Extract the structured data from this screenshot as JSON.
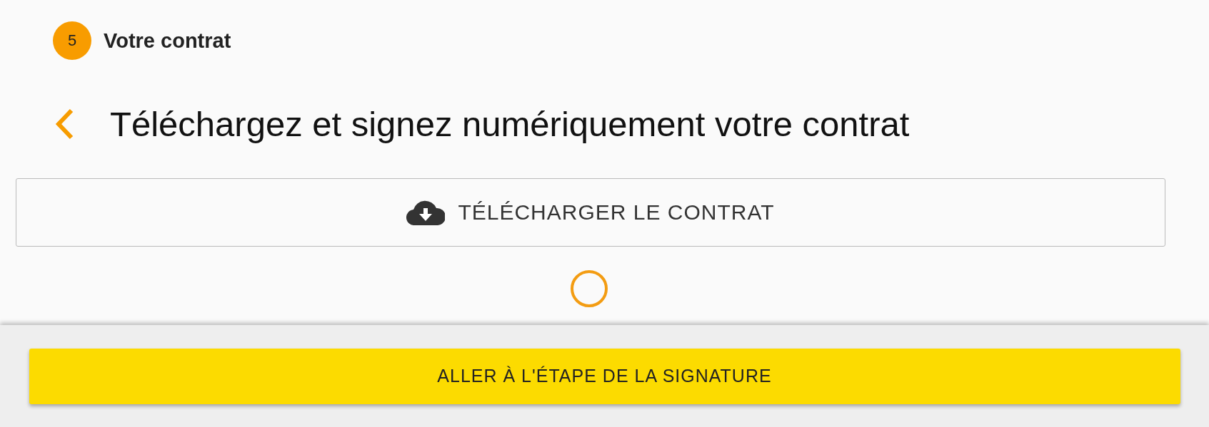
{
  "step": {
    "number": "5",
    "title": "Votre contrat"
  },
  "heading": "Téléchargez et signez numériquement votre contrat",
  "download_button": "TÉLÉCHARGER LE CONTRAT",
  "footer": {
    "button": "ALLER À L'ÉTAPE DE LA SIGNATURE"
  }
}
